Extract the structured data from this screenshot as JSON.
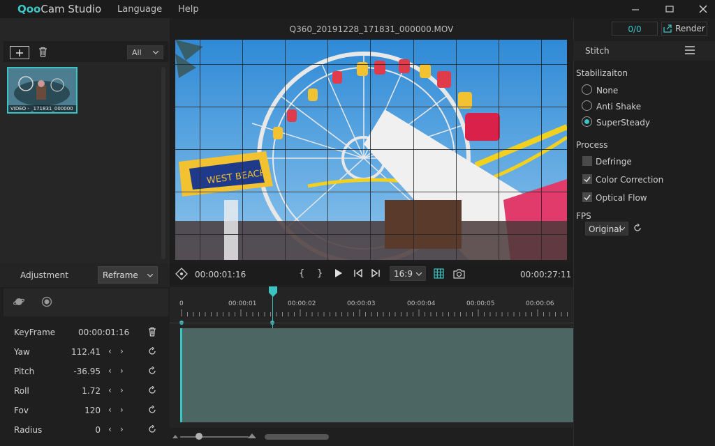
{
  "app": {
    "logo_q": "Qoo",
    "logo_rest": "Cam Studio",
    "menu": [
      "Language",
      "Help"
    ]
  },
  "media": {
    "filter": "All",
    "thumb_label": "VIDEO - _171831_000000"
  },
  "preview": {
    "filename": "Q360_20191228_171831_000000.MOV",
    "sign_text": "WEST BEACH"
  },
  "transport": {
    "current_time": "00:00:01:16",
    "total_time": "00:00:27:11",
    "aspect": "16:9",
    "bracket_in": "{",
    "bracket_out": "}"
  },
  "right": {
    "counter": "0/0",
    "render_label": "Render",
    "stitch_title": "Stitch",
    "stabilization_label": "Stabilizaiton",
    "stabilization_options": [
      "None",
      "Anti Shake",
      "SuperSteady"
    ],
    "stabilization_selected": "SuperSteady",
    "process_label": "Process",
    "process_options": [
      {
        "label": "Defringe",
        "checked": false
      },
      {
        "label": "Color Correction",
        "checked": true
      },
      {
        "label": "Optical Flow",
        "checked": true
      }
    ],
    "fps_label": "FPS",
    "fps_value": "Original"
  },
  "adjustment": {
    "title": "Adjustment",
    "mode": "Reframe",
    "keyframe_label": "KeyFrame",
    "keyframe_time": "00:00:01:16",
    "params": [
      {
        "label": "Yaw",
        "value": "112.41"
      },
      {
        "label": "Pitch",
        "value": "-36.95"
      },
      {
        "label": "Roll",
        "value": "1.72"
      },
      {
        "label": "Fov",
        "value": "120"
      },
      {
        "label": "Radius",
        "value": "0"
      }
    ]
  },
  "timeline": {
    "ruler": [
      "0",
      "00:00:01",
      "00:00:02",
      "00:00:03",
      "00:00:04",
      "00:00:05",
      "00:00:06"
    ]
  },
  "colors": {
    "accent": "#3cc4c4",
    "track": "#4b6663",
    "background": "#1e1e1e"
  }
}
